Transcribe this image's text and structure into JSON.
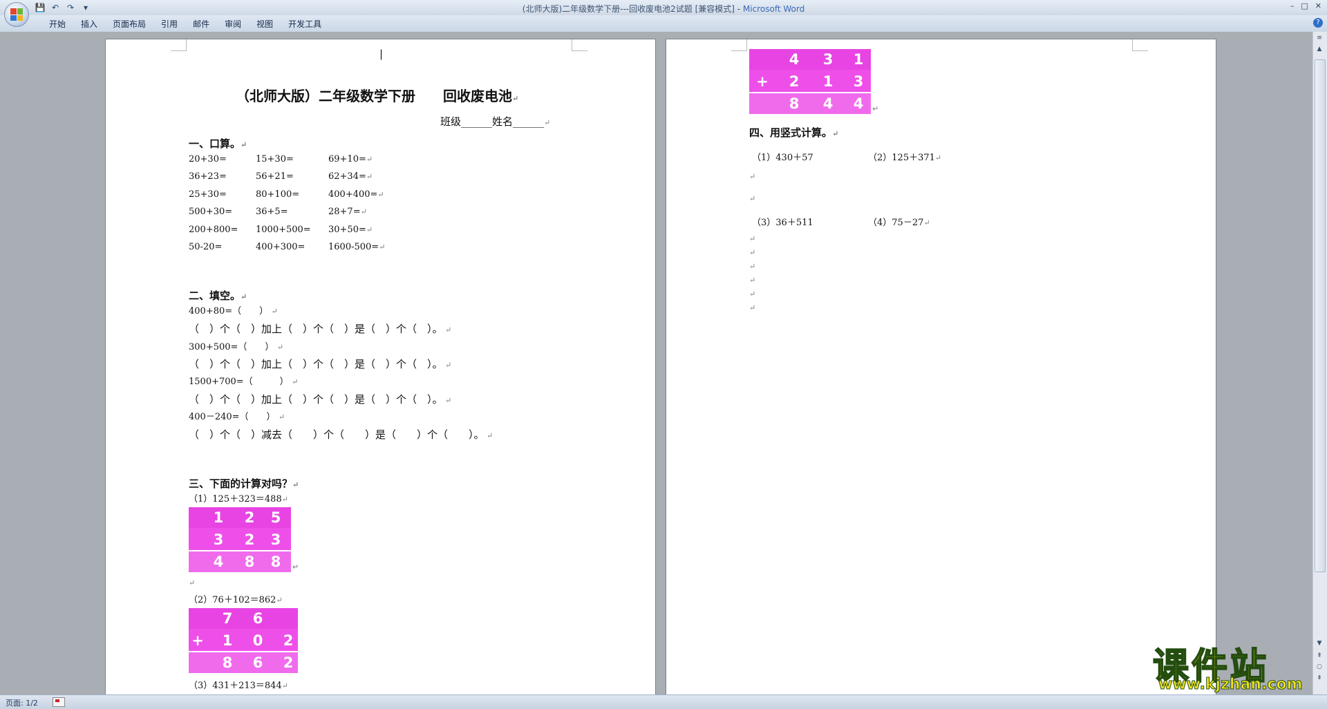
{
  "window": {
    "title": "(北师大版)二年级数学下册---回收废电池2试题 [兼容模式]",
    "app_name": "Microsoft Word",
    "controls": [
      "–",
      "□",
      "✕"
    ]
  },
  "qat": [
    "save-icon",
    "undo-icon",
    "redo-icon",
    "customize-icon"
  ],
  "ribbon": {
    "tabs": [
      "开始",
      "插入",
      "页面布局",
      "引用",
      "邮件",
      "审阅",
      "视图",
      "开发工具"
    ],
    "help": "?"
  },
  "page1": {
    "cursor": "|",
    "title": "（北师大版）二年级数学下册　　回收废电池",
    "class_line": "班级______姓名______",
    "sec1": "一、口算。",
    "oral": [
      [
        "20+30=",
        "15+30=",
        "69+10="
      ],
      [
        "36+23=",
        "56+21=",
        "62+34="
      ],
      [
        "25+30=",
        "80+100=",
        "400+400="
      ],
      [
        "500+30=",
        "36+5=",
        "28+7="
      ],
      [
        "200+800=",
        "1000+500=",
        "30+50="
      ],
      [
        "50-20=",
        "400+300=",
        "1600-500="
      ]
    ],
    "sec2": "二、填空。",
    "fill": [
      "400+80=（　　）",
      "（　）个（　）加上（　）个（　）是（　）个（　）。",
      "300+500=（　　）",
      "（　）个（　）加上（　）个（　）是（　）个（　）。",
      "1500+700=（　　　）",
      "（　）个（　）加上（　）个（　）是（　）个（　）。",
      "400－240=（　　）",
      "（　）个（　）减去（　　）个（　　）是（　　）个（　　）。"
    ],
    "sec3": "三、下面的计算对吗？",
    "q1": "（1）125＋323＝488",
    "q2": "（2）76＋102＝862",
    "q3": "（3）431＋213＝844",
    "calc1": {
      "r1": [
        "1",
        "2",
        "5"
      ],
      "r2": [
        "3",
        "2",
        "3"
      ],
      "r3": [
        "4",
        "8",
        "8"
      ]
    },
    "calc2": {
      "r1": [
        "7",
        "6"
      ],
      "op": "+",
      "r2": [
        "1",
        "0",
        "2"
      ],
      "r3": [
        "8",
        "6",
        "2"
      ]
    }
  },
  "page2": {
    "calc3": {
      "r1": [
        "4",
        "3",
        "1"
      ],
      "op": "+",
      "r2": [
        "2",
        "1",
        "3"
      ],
      "r3": [
        "8",
        "4",
        "4"
      ]
    },
    "sec4": "四、用竖式计算。",
    "p1": "（1）430＋57",
    "p2": "（2）125＋371",
    "p3": "（3）36＋511",
    "p4": "（4）75－27"
  },
  "status": {
    "page": "页面: 1/2"
  },
  "watermark": {
    "big": "课件站",
    "url": "www.kjzhan.com"
  },
  "colors": {
    "calc_bg": "#ee4fe8",
    "calc_text": "#ffffff",
    "logo_fill": "#f1e21e",
    "logo_stroke": "#244d10"
  }
}
